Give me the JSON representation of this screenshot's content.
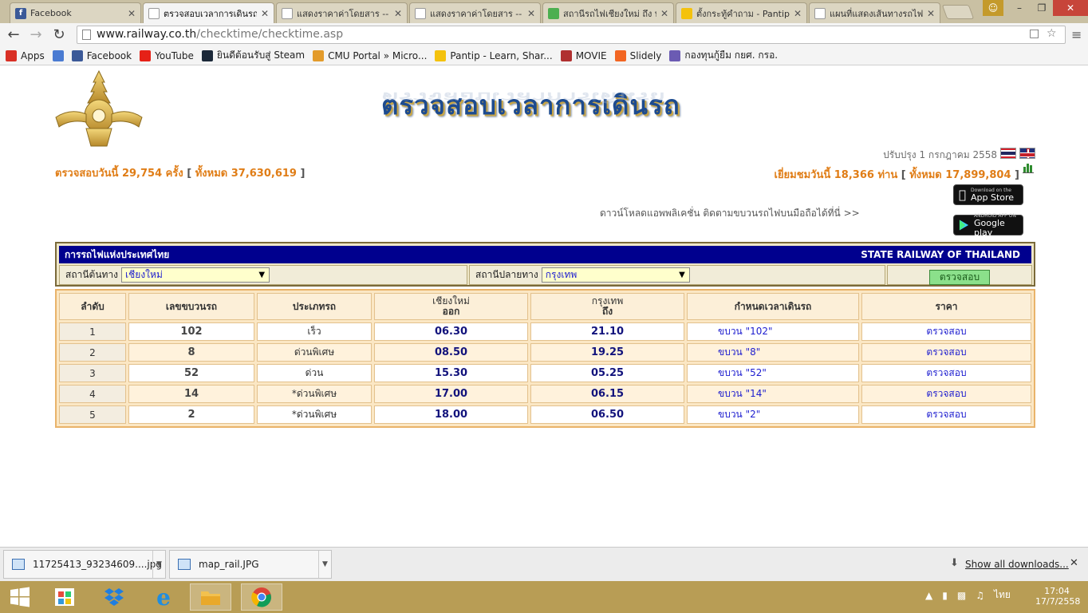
{
  "browser": {
    "tabs": [
      {
        "title": "Facebook",
        "icon": "facebook-icon",
        "color": "#3b5998",
        "active": false
      },
      {
        "title": "ตรวจสอบเวลาการเดินรถ",
        "icon": "page-icon",
        "color": "#ffffff",
        "active": true
      },
      {
        "title": "แสดงราคาค่าโดยสาร --",
        "icon": "page-icon",
        "color": "#ffffff",
        "active": false
      },
      {
        "title": "แสดงราคาค่าโดยสาร --",
        "icon": "page-icon",
        "color": "#ffffff",
        "active": false
      },
      {
        "title": "สถานีรถไฟเชียงใหม่ ถึง ท",
        "icon": "maps-icon",
        "color": "#4caf50",
        "active": false
      },
      {
        "title": "ตั้งกระทู้คำถาม - Pantip",
        "icon": "pantip-icon",
        "color": "#f4c20d",
        "active": false
      },
      {
        "title": "แผนที่แสดงเส้นทางรถไฟ",
        "icon": "page-icon",
        "color": "#ffffff",
        "active": false
      }
    ],
    "url_host": "www.railway.co.th",
    "url_path": "/checktime/checktime.asp",
    "bookmarks": [
      {
        "label": "Apps",
        "icon": "apps-grid-icon",
        "color": "#d93025"
      },
      {
        "label": "",
        "icon": "google-plus-icon",
        "color": "#4a7bd2"
      },
      {
        "label": "Facebook",
        "icon": "facebook-icon",
        "color": "#3b5998"
      },
      {
        "label": "YouTube",
        "icon": "youtube-icon",
        "color": "#e62117"
      },
      {
        "label": "ยินดีต้อนรับสู่ Steam",
        "icon": "steam-icon",
        "color": "#1b2838"
      },
      {
        "label": "CMU Portal » Micro...",
        "icon": "cmu-icon",
        "color": "#e39b2b"
      },
      {
        "label": "Pantip - Learn, Shar...",
        "icon": "pantip-icon",
        "color": "#f4c20d"
      },
      {
        "label": "MOVIE",
        "icon": "movie-icon",
        "color": "#b03030"
      },
      {
        "label": "Slidely",
        "icon": "slidely-icon",
        "color": "#f26522"
      },
      {
        "label": "กองทุนกู้ยืม กยศ. กรอ.",
        "icon": "fund-icon",
        "color": "#6b5bb3"
      }
    ]
  },
  "page": {
    "banner_title": "ตรวจสอบเวลาการเดินรถ",
    "updated": "ปรับปรุง 1 กรกฎาคม 2558",
    "checks_today_label": "ตรวจสอบวันนี้",
    "checks_today_value": "29,754",
    "checks_unit": "ครั้ง",
    "checks_total_label": "ทั้งหมด",
    "checks_total_value": "37,630,619",
    "visits_today_label": "เยี่ยมชมวันนี้",
    "visits_today_value": "18,366",
    "visits_unit": "ท่าน",
    "visits_total_label": "ทั้งหมด",
    "visits_total_value": "17,899,804",
    "app_promo": "ดาวน์โหลดแอพพลิเคชั่น ติดตามขบวนรถไฟบนมือถือได้ที่นี่ >>",
    "appstore_small": "Download on the",
    "appstore_big": "App Store",
    "googleplay_small": "ANDROID APP ON",
    "googleplay_big": "Google play"
  },
  "search": {
    "header_left": "การรถไฟแห่งประเทศไทย",
    "header_right": "STATE RAILWAY OF THAILAND",
    "origin_label": "สถานีต้นทาง",
    "origin_value": "เชียงใหม่",
    "dest_label": "สถานีปลายทาง",
    "dest_value": "กรุงเทพ",
    "check_button": "ตรวจสอบ"
  },
  "table": {
    "headers": {
      "seq": "ลำดับ",
      "train_no": "เลขขบวนรถ",
      "type": "ประเภทรถ",
      "origin": "เชียงใหม่",
      "origin_sub": "ออก",
      "dest": "กรุงเทพ",
      "dest_sub": "ถึง",
      "schedule": "กำหนดเวลาเดินรถ",
      "price": "ราคา"
    },
    "rows": [
      {
        "seq": "1",
        "train_no": "102",
        "type": "เร็ว",
        "depart": "06.30",
        "arrive": "21.10",
        "schedule": "ขบวน \"102\"",
        "price": "ตรวจสอบ"
      },
      {
        "seq": "2",
        "train_no": "8",
        "type": "ด่วนพิเศษ",
        "depart": "08.50",
        "arrive": "19.25",
        "schedule": "ขบวน \"8\"",
        "price": "ตรวจสอบ"
      },
      {
        "seq": "3",
        "train_no": "52",
        "type": "ด่วน",
        "depart": "15.30",
        "arrive": "05.25",
        "schedule": "ขบวน \"52\"",
        "price": "ตรวจสอบ"
      },
      {
        "seq": "4",
        "train_no": "14",
        "type": "*ด่วนพิเศษ",
        "depart": "17.00",
        "arrive": "06.15",
        "schedule": "ขบวน \"14\"",
        "price": "ตรวจสอบ"
      },
      {
        "seq": "5",
        "train_no": "2",
        "type": "*ด่วนพิเศษ",
        "depart": "18.00",
        "arrive": "06.50",
        "schedule": "ขบวน \"2\"",
        "price": "ตรวจสอบ"
      }
    ]
  },
  "downloads": {
    "items": [
      "11725413_93234609....jpg",
      "map_rail.JPG"
    ],
    "show_all": "Show all downloads..."
  },
  "taskbar": {
    "language": "ไทย",
    "time": "17:04",
    "date": "17/7/2558"
  }
}
